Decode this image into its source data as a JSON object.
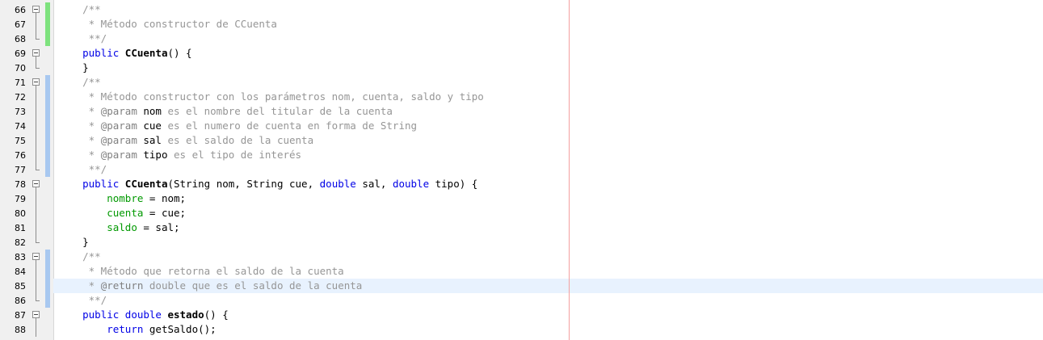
{
  "editor": {
    "lines": [
      {
        "num": "66",
        "fold": "start",
        "change": "#7ee27e",
        "tokens": [
          {
            "t": "    ",
            "c": ""
          },
          {
            "t": "/**",
            "c": "comment"
          }
        ]
      },
      {
        "num": "67",
        "fold": "mid",
        "change": "#7ee27e",
        "tokens": [
          {
            "t": "     * Método constructor de CCuenta",
            "c": "comment"
          }
        ]
      },
      {
        "num": "68",
        "fold": "end",
        "change": "#7ee27e",
        "tokens": [
          {
            "t": "     **/",
            "c": "comment"
          }
        ]
      },
      {
        "num": "69",
        "fold": "start",
        "change": "",
        "tokens": [
          {
            "t": "    ",
            "c": ""
          },
          {
            "t": "public",
            "c": "kw"
          },
          {
            "t": " ",
            "c": ""
          },
          {
            "t": "CCuenta",
            "c": "fn"
          },
          {
            "t": "() {",
            "c": ""
          }
        ]
      },
      {
        "num": "70",
        "fold": "end",
        "change": "",
        "tokens": [
          {
            "t": "    }",
            "c": ""
          }
        ]
      },
      {
        "num": "71",
        "fold": "start",
        "change": "#a8c8f0",
        "tokens": [
          {
            "t": "    ",
            "c": ""
          },
          {
            "t": "/**",
            "c": "comment"
          }
        ]
      },
      {
        "num": "72",
        "fold": "mid",
        "change": "#a8c8f0",
        "tokens": [
          {
            "t": "     * Método constructor con los parámetros nom, cuenta, saldo y tipo",
            "c": "comment"
          }
        ]
      },
      {
        "num": "73",
        "fold": "mid",
        "change": "#a8c8f0",
        "tokens": [
          {
            "t": "     * ",
            "c": "comment"
          },
          {
            "t": "@param",
            "c": "tag"
          },
          {
            "t": " ",
            "c": ""
          },
          {
            "t": "nom",
            "c": ""
          },
          {
            "t": " es el nombre del titular de la cuenta",
            "c": "comment"
          }
        ]
      },
      {
        "num": "74",
        "fold": "mid",
        "change": "#a8c8f0",
        "tokens": [
          {
            "t": "     * ",
            "c": "comment"
          },
          {
            "t": "@param",
            "c": "tag"
          },
          {
            "t": " ",
            "c": ""
          },
          {
            "t": "cue",
            "c": ""
          },
          {
            "t": " es el numero de cuenta en forma de String",
            "c": "comment"
          }
        ]
      },
      {
        "num": "75",
        "fold": "mid",
        "change": "#a8c8f0",
        "tokens": [
          {
            "t": "     * ",
            "c": "comment"
          },
          {
            "t": "@param",
            "c": "tag"
          },
          {
            "t": " ",
            "c": ""
          },
          {
            "t": "sal",
            "c": ""
          },
          {
            "t": " es el saldo de la cuenta",
            "c": "comment"
          }
        ]
      },
      {
        "num": "76",
        "fold": "mid",
        "change": "#a8c8f0",
        "tokens": [
          {
            "t": "     * ",
            "c": "comment"
          },
          {
            "t": "@param",
            "c": "tag"
          },
          {
            "t": " ",
            "c": ""
          },
          {
            "t": "tipo",
            "c": ""
          },
          {
            "t": " es el tipo de interés",
            "c": "comment"
          }
        ]
      },
      {
        "num": "77",
        "fold": "end",
        "change": "#a8c8f0",
        "tokens": [
          {
            "t": "     **/",
            "c": "comment"
          }
        ]
      },
      {
        "num": "78",
        "fold": "start",
        "change": "",
        "tokens": [
          {
            "t": "    ",
            "c": ""
          },
          {
            "t": "public",
            "c": "kw"
          },
          {
            "t": " ",
            "c": ""
          },
          {
            "t": "CCuenta",
            "c": "fn"
          },
          {
            "t": "(String nom, String cue, ",
            "c": ""
          },
          {
            "t": "double",
            "c": "kw"
          },
          {
            "t": " sal, ",
            "c": ""
          },
          {
            "t": "double",
            "c": "kw"
          },
          {
            "t": " tipo) {",
            "c": ""
          }
        ]
      },
      {
        "num": "79",
        "fold": "mid",
        "change": "",
        "tokens": [
          {
            "t": "        ",
            "c": ""
          },
          {
            "t": "nombre",
            "c": "field"
          },
          {
            "t": " = nom;",
            "c": ""
          }
        ]
      },
      {
        "num": "80",
        "fold": "mid",
        "change": "",
        "tokens": [
          {
            "t": "        ",
            "c": ""
          },
          {
            "t": "cuenta",
            "c": "field"
          },
          {
            "t": " = cue;",
            "c": ""
          }
        ]
      },
      {
        "num": "81",
        "fold": "mid",
        "change": "",
        "tokens": [
          {
            "t": "        ",
            "c": ""
          },
          {
            "t": "saldo",
            "c": "field"
          },
          {
            "t": " = sal;",
            "c": ""
          }
        ]
      },
      {
        "num": "82",
        "fold": "end",
        "change": "",
        "tokens": [
          {
            "t": "    }",
            "c": ""
          }
        ]
      },
      {
        "num": "83",
        "fold": "start",
        "change": "#a8c8f0",
        "tokens": [
          {
            "t": "    ",
            "c": ""
          },
          {
            "t": "/**",
            "c": "comment"
          }
        ]
      },
      {
        "num": "84",
        "fold": "mid",
        "change": "#a8c8f0",
        "tokens": [
          {
            "t": "     * Método que retorna el saldo de la cuenta",
            "c": "comment"
          }
        ]
      },
      {
        "num": "85",
        "fold": "mid",
        "change": "#a8c8f0",
        "current": true,
        "tokens": [
          {
            "t": "     * ",
            "c": "comment"
          },
          {
            "t": "@return",
            "c": "tag"
          },
          {
            "t": " double que es el saldo de la cuenta",
            "c": "comment"
          }
        ]
      },
      {
        "num": "86",
        "fold": "end",
        "change": "#a8c8f0",
        "tokens": [
          {
            "t": "     **/",
            "c": "comment"
          }
        ]
      },
      {
        "num": "87",
        "fold": "start",
        "change": "",
        "tokens": [
          {
            "t": "    ",
            "c": ""
          },
          {
            "t": "public",
            "c": "kw"
          },
          {
            "t": " ",
            "c": ""
          },
          {
            "t": "double",
            "c": "kw"
          },
          {
            "t": " ",
            "c": ""
          },
          {
            "t": "estado",
            "c": "fn"
          },
          {
            "t": "() {",
            "c": ""
          }
        ]
      },
      {
        "num": "88",
        "fold": "mid",
        "change": "",
        "tokens": [
          {
            "t": "        ",
            "c": ""
          },
          {
            "t": "return",
            "c": "kw"
          },
          {
            "t": " getSaldo();",
            "c": ""
          }
        ]
      }
    ]
  }
}
